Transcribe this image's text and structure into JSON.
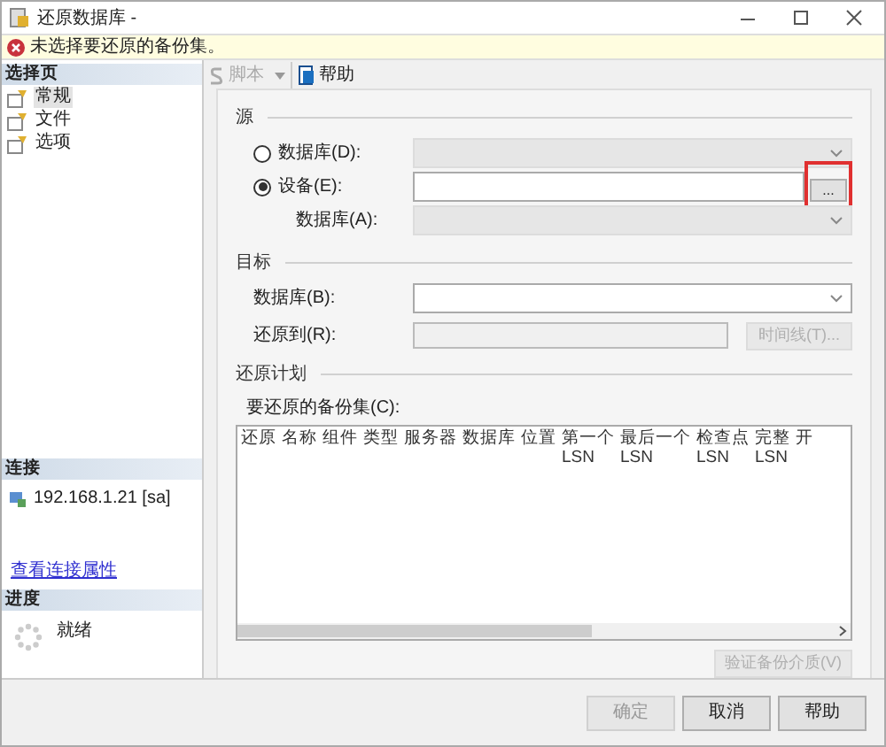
{
  "window": {
    "title": "还原数据库 -"
  },
  "error_banner": {
    "message": "未选择要还原的备份集。"
  },
  "sidebar": {
    "select_page": {
      "header": "选择页",
      "items": [
        {
          "label": "常规",
          "selected": true
        },
        {
          "label": "文件",
          "selected": false
        },
        {
          "label": "选项",
          "selected": false
        }
      ]
    },
    "connection": {
      "header": "连接",
      "server": "192.168.1.21 [sa]",
      "link": "查看连接属性"
    },
    "progress": {
      "header": "进度",
      "status": "就绪"
    }
  },
  "toolbar": [
    {
      "label": "脚本",
      "kind": "dropdown",
      "disabled": true
    },
    {
      "label": "帮助",
      "kind": "help",
      "disabled": false
    }
  ],
  "source": {
    "title": "源",
    "options": [
      {
        "label": "数据库(D):",
        "selected": false,
        "disabled": true
      },
      {
        "label": "设备(E):",
        "selected": true,
        "disabled": false
      }
    ],
    "browse_button": "...",
    "database_label": "数据库(A):",
    "database_disabled": true
  },
  "target": {
    "title": "目标",
    "database_label": "数据库(B):",
    "restore_to_label": "还原到(R):",
    "timeline_button": {
      "label": "时间线(T)...",
      "disabled": true
    }
  },
  "plan": {
    "title": "还原计划",
    "table_label": "要还原的备份集(C):",
    "columns": [
      "还原",
      "名称",
      "组件",
      "类型",
      "服务器",
      "数据库",
      "位置",
      "第一个 LSN",
      "最后一个 LSN",
      "检查点 LSN",
      "完整 LSN",
      "开"
    ]
  },
  "verify_button": {
    "label": "验证备份介质(V)",
    "disabled": true
  },
  "buttons": [
    {
      "label": "确定",
      "disabled": true
    },
    {
      "label": "取消",
      "disabled": false
    },
    {
      "label": "帮助",
      "disabled": false
    }
  ]
}
